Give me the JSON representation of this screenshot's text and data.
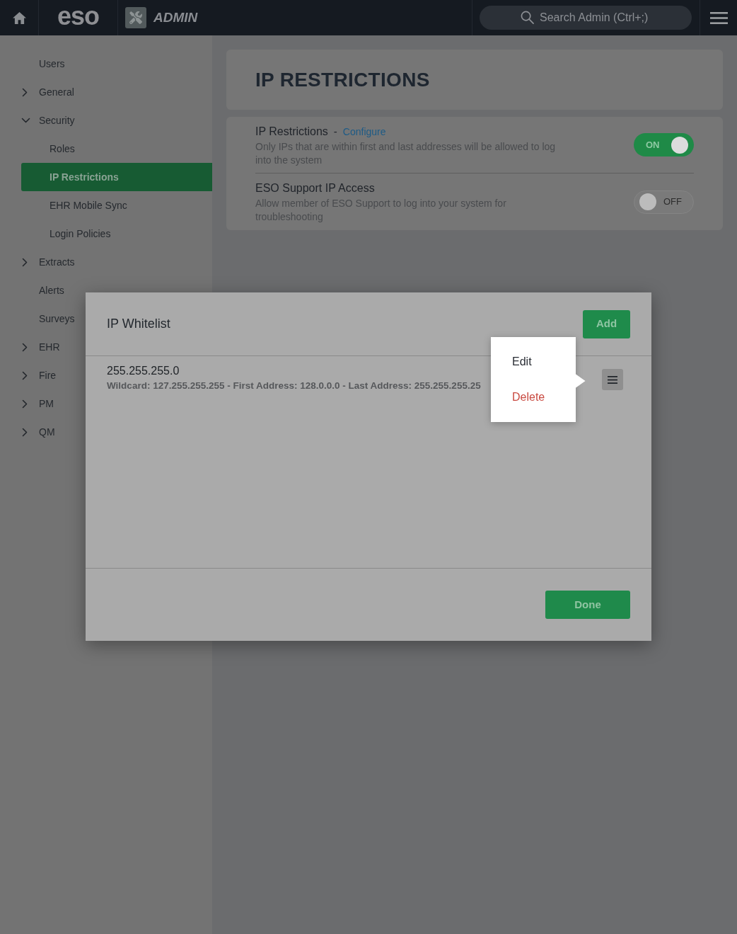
{
  "header": {
    "logo": "eso",
    "app_name": "ADMIN",
    "search": {
      "placeholder": "Search Admin (Ctrl+;)"
    }
  },
  "sidebar": {
    "items": [
      {
        "label": "Users",
        "kind": "link",
        "selected": false
      },
      {
        "label": "General",
        "kind": "group",
        "expanded": false,
        "selected": false
      },
      {
        "label": "Security",
        "kind": "group",
        "expanded": true,
        "selected": false,
        "children": [
          {
            "label": "Roles",
            "selected": false
          },
          {
            "label": "IP Restrictions",
            "selected": true
          },
          {
            "label": "EHR Mobile Sync",
            "selected": false
          },
          {
            "label": "Login Policies",
            "selected": false
          }
        ]
      },
      {
        "label": "Extracts",
        "kind": "group",
        "expanded": false,
        "selected": false
      },
      {
        "label": "Alerts",
        "kind": "link",
        "selected": false
      },
      {
        "label": "Surveys",
        "kind": "link",
        "selected": false
      },
      {
        "label": "EHR",
        "kind": "group",
        "expanded": false,
        "selected": false
      },
      {
        "label": "Fire",
        "kind": "group",
        "expanded": false,
        "selected": false
      },
      {
        "label": "PM",
        "kind": "group",
        "expanded": false,
        "selected": false
      },
      {
        "label": "QM",
        "kind": "group",
        "expanded": false,
        "selected": false
      }
    ]
  },
  "page": {
    "title": "IP RESTRICTIONS",
    "settings": [
      {
        "title": "IP Restrictions",
        "separator": "-",
        "link": "Configure",
        "description": "Only IPs that are within first and last addresses will be allowed to log into the system",
        "on": true,
        "switch_label": "ON"
      },
      {
        "title": "ESO Support IP Access",
        "description": "Allow member of ESO Support to log into your system for troubleshooting",
        "on": false,
        "switch_label": "OFF"
      }
    ]
  },
  "dialog": {
    "title": "IP Whitelist",
    "add_button": "Add",
    "entries": [
      {
        "address": "255.255.255.0",
        "details": "Wildcard: 127.255.255.255 - First Address: 128.0.0.0 - Last Address: 255.255.255.25"
      }
    ],
    "done_button": "Done"
  },
  "context_menu": {
    "items": [
      {
        "label": "Edit",
        "kind": "default"
      },
      {
        "label": "Delete",
        "kind": "danger"
      }
    ]
  }
}
